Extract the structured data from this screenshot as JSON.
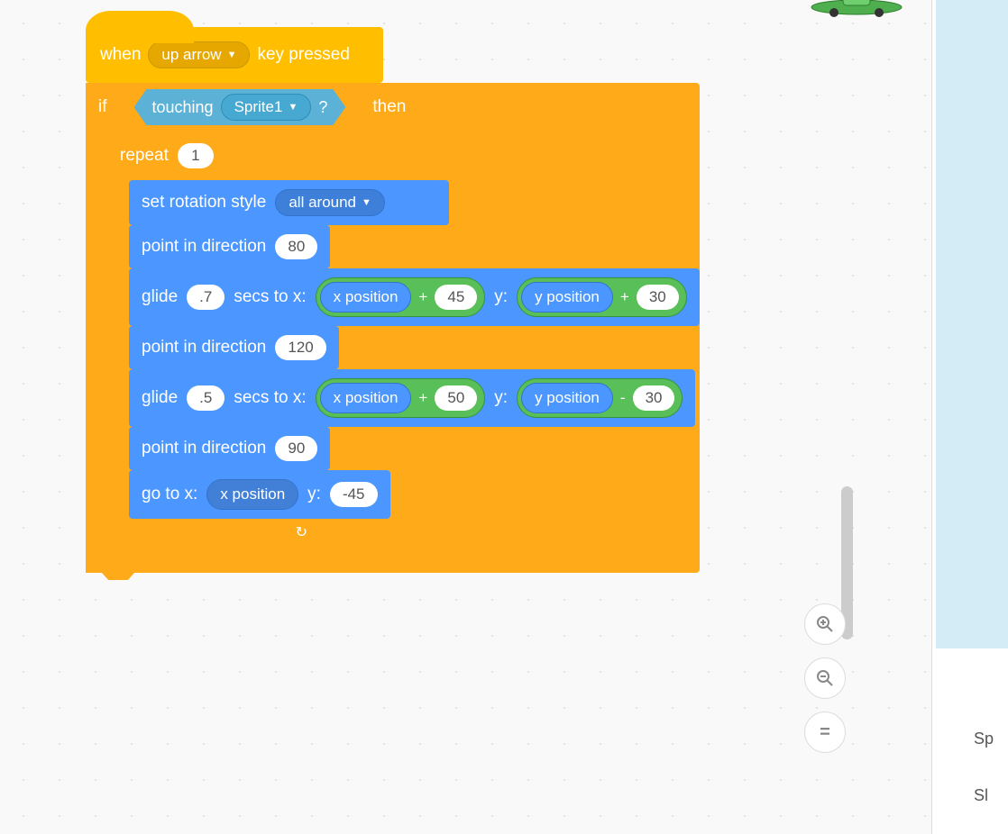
{
  "hat": {
    "when": "when",
    "key": "up arrow",
    "suffix": "key pressed"
  },
  "if_block": {
    "if": "if",
    "then": "then"
  },
  "sensing": {
    "touching": "touching",
    "target": "Sprite1",
    "q": "?"
  },
  "repeat": {
    "label": "repeat",
    "count": "1"
  },
  "rot_style": {
    "label": "set rotation style",
    "value": "all around"
  },
  "point1": {
    "label": "point in direction",
    "value": "80"
  },
  "glide1": {
    "glide": "glide",
    "secs": ".7",
    "secs_to_x": "secs to x:",
    "xpos": "x position",
    "op1": "+",
    "xoff": "45",
    "ylab": "y:",
    "ypos": "y position",
    "op2": "+",
    "yoff": "30"
  },
  "point2": {
    "label": "point in direction",
    "value": "120"
  },
  "glide2": {
    "glide": "glide",
    "secs": ".5",
    "secs_to_x": "secs to x:",
    "xpos": "x position",
    "op1": "+",
    "xoff": "50",
    "ylab": "y:",
    "ypos": "y position",
    "op2": "-",
    "yoff": "30"
  },
  "point3": {
    "label": "point in direction",
    "value": "90"
  },
  "goto": {
    "label": "go to x:",
    "xpos": "x position",
    "ylab": "y:",
    "yval": "-45"
  },
  "zoom": {
    "in": "+",
    "out": "−",
    "reset": "="
  },
  "side": {
    "sp": "Sp",
    "sl": "Sl"
  },
  "loop_icon": "↺"
}
